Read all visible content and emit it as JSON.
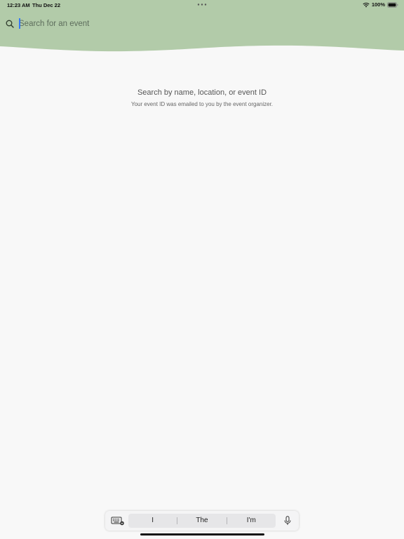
{
  "status_bar": {
    "time": "12:23 AM",
    "date": "Thu Dec 22",
    "battery": "100%"
  },
  "colors": {
    "header_green": "#b2cba9",
    "background": "#f8f8f8",
    "caret": "#3478f6"
  },
  "search": {
    "placeholder": "Search for an event",
    "value": ""
  },
  "empty_state": {
    "title": "Search by name, location, or event ID",
    "subtitle": "Your event ID was emailed to you by the event organizer."
  },
  "keyboard_bar": {
    "suggestions": [
      "I",
      "The",
      "I'm"
    ]
  },
  "icons": [
    "wifi-icon",
    "battery-icon",
    "search-icon",
    "keyboard-hide-icon",
    "microphone-icon"
  ]
}
